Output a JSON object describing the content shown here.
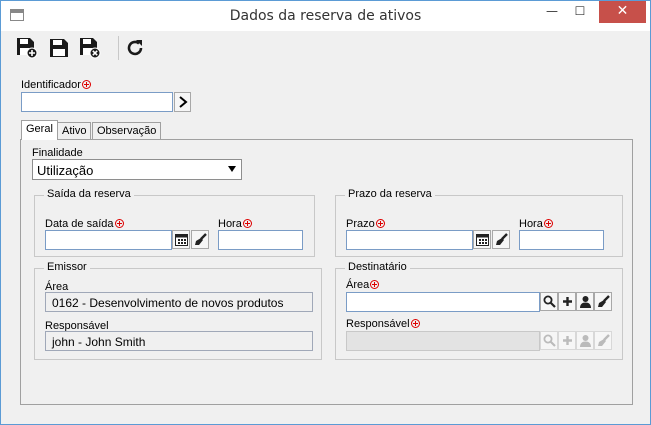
{
  "window": {
    "title": "Dados da reserva de ativos"
  },
  "toolbar": {
    "buttons": [
      "save-new-icon",
      "save-icon",
      "save-close-icon",
      "refresh-icon"
    ]
  },
  "identifier": {
    "label": "Identificador",
    "value": ""
  },
  "tabs": [
    {
      "label": "Geral",
      "active": true
    },
    {
      "label": "Ativo",
      "active": false
    },
    {
      "label": "Observação",
      "active": false
    }
  ],
  "purpose": {
    "label": "Finalidade",
    "selected": "Utilização"
  },
  "departure": {
    "group_title": "Saída da reserva",
    "date_label": "Data de saída",
    "date_value": "",
    "time_label": "Hora",
    "time_value": ""
  },
  "deadline": {
    "group_title": "Prazo da reserva",
    "date_label": "Prazo",
    "date_value": "",
    "time_label": "Hora",
    "time_value": ""
  },
  "issuer": {
    "group_title": "Emissor",
    "area_label": "Área",
    "area_value": "0162 - Desenvolvimento de novos produtos",
    "responsible_label": "Responsável",
    "responsible_value": "john - John Smith"
  },
  "recipient": {
    "group_title": "Destinatário",
    "area_label": "Área",
    "area_value": "",
    "responsible_label": "Responsável",
    "responsible_value": ""
  },
  "colors": {
    "required": "#dd0000",
    "input_border": "#7a9cc6",
    "close_button": "#c7504a"
  }
}
